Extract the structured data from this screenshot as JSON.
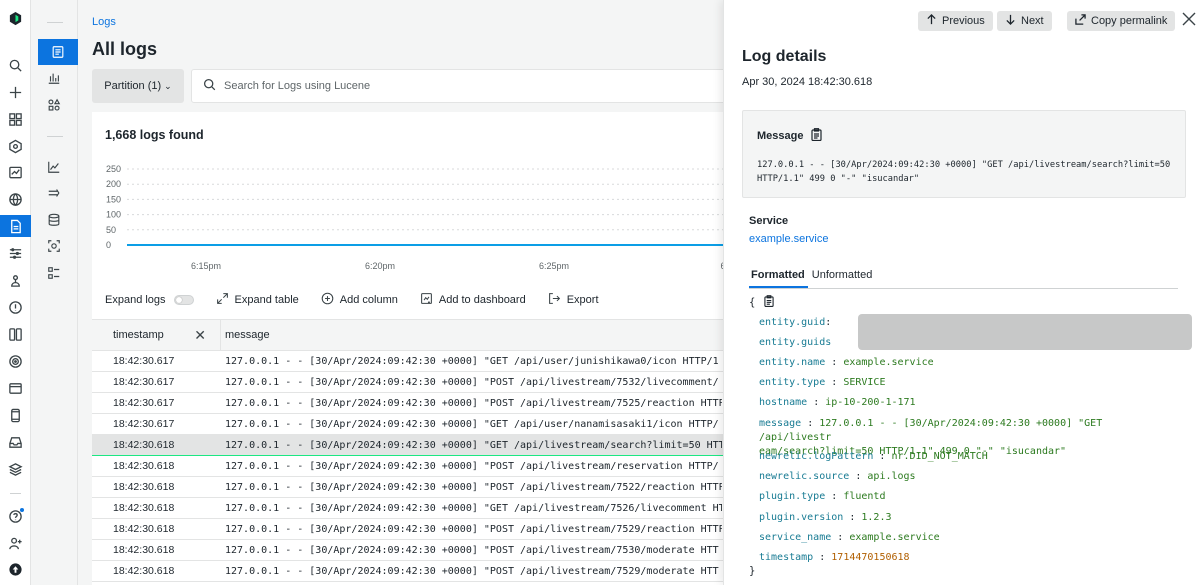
{
  "breadcrumb": "Logs",
  "page_title": "All logs",
  "partition_label": "Partition (1)",
  "search": {
    "placeholder": "Search for Logs using Lucene",
    "value": ""
  },
  "logs_found": "1,668 logs found",
  "chart_data": {
    "type": "line",
    "title": "",
    "xlabel": "",
    "ylabel": "",
    "y_ticks": [
      "250",
      "200",
      "150",
      "100",
      "50",
      "0"
    ],
    "x_ticks": [
      "6:15pm",
      "6:20pm",
      "6:25pm",
      "6:"
    ],
    "ylim": [
      0,
      250
    ],
    "grid": true,
    "series": [
      {
        "values": [
          0,
          0,
          0,
          0,
          0,
          0,
          0,
          0,
          0,
          0
        ]
      }
    ],
    "colors": {
      "line": "#0c9ee6",
      "grid": "#d8dadb"
    }
  },
  "toolbar": {
    "expand_logs": "Expand logs",
    "expand_table": "Expand table",
    "add_column": "Add column",
    "add_to_dashboard": "Add to dashboard",
    "export": "Export"
  },
  "table": {
    "columns": [
      "timestamp",
      "message"
    ],
    "rows": [
      {
        "timestamp": "18:42:30.617",
        "message": "127.0.0.1 - - [30/Apr/2024:09:42:30 +0000] \"GET /api/user/junishikawa0/icon HTTP/1"
      },
      {
        "timestamp": "18:42:30.617",
        "message": "127.0.0.1 - - [30/Apr/2024:09:42:30 +0000] \"POST /api/livestream/7532/livecomment/"
      },
      {
        "timestamp": "18:42:30.617",
        "message": "127.0.0.1 - - [30/Apr/2024:09:42:30 +0000] \"POST /api/livestream/7525/reaction HTTP"
      },
      {
        "timestamp": "18:42:30.617",
        "message": "127.0.0.1 - - [30/Apr/2024:09:42:30 +0000] \"GET /api/user/nanamisasaki1/icon HTTP/"
      },
      {
        "timestamp": "18:42:30.618",
        "message": "127.0.0.1 - - [30/Apr/2024:09:42:30 +0000] \"GET /api/livestream/search?limit=50 HTT"
      },
      {
        "timestamp": "18:42:30.618",
        "message": "127.0.0.1 - - [30/Apr/2024:09:42:30 +0000] \"POST /api/livestream/reservation HTTP/"
      },
      {
        "timestamp": "18:42:30.618",
        "message": "127.0.0.1 - - [30/Apr/2024:09:42:30 +0000] \"POST /api/livestream/7522/reaction HTTP"
      },
      {
        "timestamp": "18:42:30.618",
        "message": "127.0.0.1 - - [30/Apr/2024:09:42:30 +0000] \"GET /api/livestream/7526/livecomment HT"
      },
      {
        "timestamp": "18:42:30.618",
        "message": "127.0.0.1 - - [30/Apr/2024:09:42:30 +0000] \"POST /api/livestream/7529/reaction HTTP"
      },
      {
        "timestamp": "18:42:30.618",
        "message": "127.0.0.1 - - [30/Apr/2024:09:42:30 +0000] \"POST /api/livestream/7530/moderate HTT"
      },
      {
        "timestamp": "18:42:30.618",
        "message": "127.0.0.1 - - [30/Apr/2024:09:42:30 +0000] \"POST /api/livestream/7529/moderate HTT"
      }
    ],
    "selected_row": 4
  },
  "drawer": {
    "previous": "Previous",
    "next": "Next",
    "copy_permalink": "Copy permalink",
    "title": "Log details",
    "date": "Apr 30, 2024 18:42:30.618",
    "message_label": "Message",
    "message_line1": "127.0.0.1 - - [30/Apr/2024:09:42:30 +0000] \"GET /api/livestream/search?limit=50",
    "message_line2": "HTTP/1.1\" 499 0 \"-\" \"isucandar\"",
    "service_label": "Service",
    "service_value": "example.service",
    "tab_formatted": "Formatted",
    "tab_unformatted": "Unformatted",
    "json_open": "{",
    "json_close": "}",
    "fields": {
      "entity_guid_key": "entity.guid",
      "entity_guids_key": "entity.guids",
      "entity_name_key": "entity.name",
      "entity_name_val": "example.service",
      "entity_type_key": "entity.type",
      "entity_type_val": "SERVICE",
      "hostname_key": "hostname",
      "hostname_val": "ip-10-200-1-171",
      "message_key": "message",
      "message_val_1": "127.0.0.1 - - [30/Apr/2024:09:42:30 +0000] \"GET /api/livestr",
      "message_val_2": "eam/search?limit=50 HTTP/1.1\" 499 0 \"-\" \"isucandar\"",
      "logpattern_key": "newrelic.logPattern",
      "logpattern_val": "nr.DID_NOT_MATCH",
      "source_key": "newrelic.source",
      "source_val": "api.logs",
      "plugin_type_key": "plugin.type",
      "plugin_type_val": "fluentd",
      "plugin_version_key": "plugin.version",
      "plugin_version_val": "1.2.3",
      "service_name_key": "service_name",
      "service_name_val": "example.service",
      "timestamp_key": "timestamp",
      "timestamp_val": "1714470150618"
    },
    "separator": ":"
  },
  "colors": {
    "accent": "#0c74df",
    "selected_row_border": "#1ce783"
  }
}
